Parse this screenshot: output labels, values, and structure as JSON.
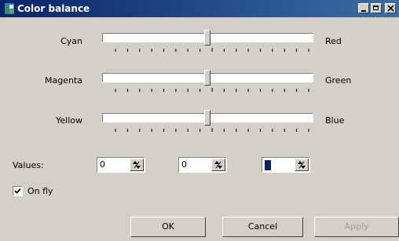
{
  "window": {
    "title": "Color balance"
  },
  "sliders": [
    {
      "left": "Cyan",
      "right": "Red",
      "value": 0
    },
    {
      "left": "Magenta",
      "right": "Green",
      "value": 0
    },
    {
      "left": "Yellow",
      "right": "Blue",
      "value": 0
    }
  ],
  "values_label": "Values:",
  "spinners": [
    "0",
    "0",
    "0"
  ],
  "on_fly": {
    "label": "On fly",
    "checked": true
  },
  "buttons": {
    "ok": "OK",
    "cancel": "Cancel",
    "apply": "Apply"
  }
}
